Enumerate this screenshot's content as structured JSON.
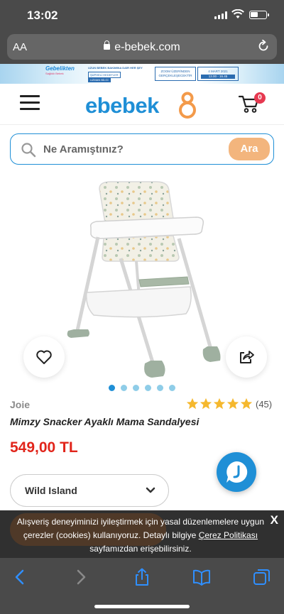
{
  "status_bar": {
    "time": "13:02"
  },
  "browser": {
    "text_size_label": "AA",
    "url": "e-bebek.com"
  },
  "promo_banner": {
    "logo_line1": "Gebelikten",
    "logo_line2": "Sağlıklı Bebek",
    "line1": "UZUN BEBEK BAKIMINA DAİR HER ŞEY",
    "line2": "ŞÜPHELİ HEDEFLER",
    "line3": "UZMAN BİLGİ",
    "box1": "ZOOM ÜZERİNDEN GERÇEKLEŞECEKTİR",
    "box2_date": "4 MART 2021",
    "box2_time": "13.00 - 16.45"
  },
  "header": {
    "brand": "ebebek",
    "cart_count": "0"
  },
  "search": {
    "placeholder": "Ne Aramıştınız?",
    "button_label": "Ara"
  },
  "carousel": {
    "total": 6,
    "active_index": 0
  },
  "product": {
    "brand": "Joie",
    "title": "Mimzy Snacker Ayaklı Mama Sandalyesi",
    "price": "549,00 TL",
    "rating": 5,
    "review_count": "(45)",
    "variant": "Wild Island"
  },
  "cookie_banner": {
    "text_before_link": "Alışveriş deneyiminizi iyileştirmek için yasal düzenlemelere uygun çerezler (cookies) kullanıyoruz. Detaylı bilgiye ",
    "link": "Çerez Politikası",
    "text_after_link": " sayfamızdan erişebilirsiniz.",
    "close": "X"
  },
  "colors": {
    "brand_blue": "#1f8fd6",
    "brand_orange": "#f3b57d",
    "price_red": "#e1251b",
    "star_yellow": "#f5b82e"
  },
  "icons": [
    "lock-icon",
    "reload-icon",
    "hamburger-icon",
    "cart-icon",
    "search-icon",
    "heart-icon",
    "share-icon",
    "chevron-down-icon",
    "chat-icon",
    "back-icon",
    "forward-icon",
    "share-sheet-icon",
    "bookmarks-icon",
    "tabs-icon"
  ]
}
